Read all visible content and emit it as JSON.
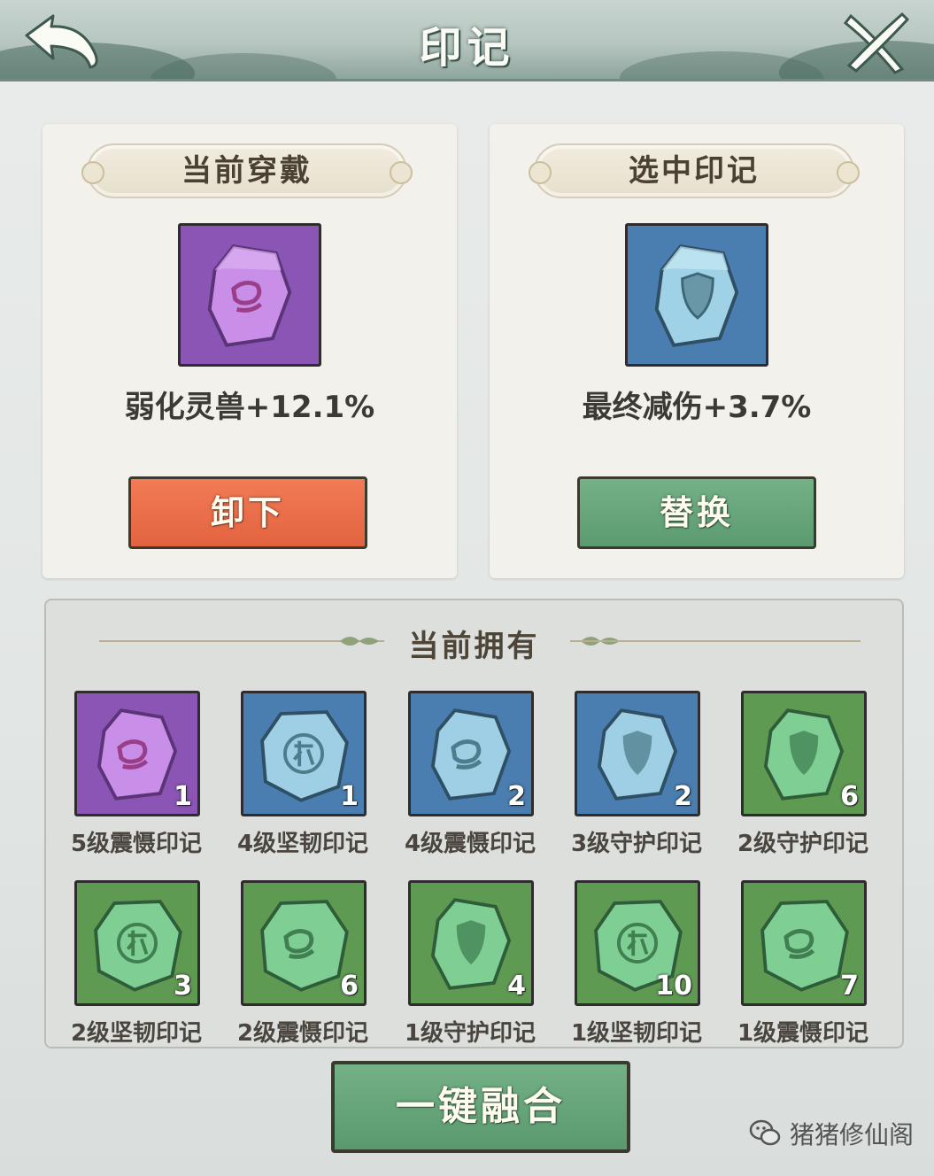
{
  "header": {
    "title": "印记"
  },
  "equipped_panel": {
    "label": "当前穿戴",
    "item_icon": "purple-beast-rune-icon",
    "stat": "弱化灵兽+12.1%",
    "button": "卸下"
  },
  "selected_panel": {
    "label": "选中印记",
    "item_icon": "blue-shield-rune-icon",
    "stat": "最终减伤+3.7%",
    "button": "替换"
  },
  "owned": {
    "title": "当前拥有",
    "items": [
      {
        "name": "5级震慑印记",
        "count": "1",
        "rarity": "purple",
        "glyph": "beast"
      },
      {
        "name": "4级坚韧印记",
        "count": "1",
        "rarity": "blue",
        "glyph": "rune"
      },
      {
        "name": "4级震慑印记",
        "count": "2",
        "rarity": "blue",
        "glyph": "beast"
      },
      {
        "name": "3级守护印记",
        "count": "2",
        "rarity": "blue",
        "glyph": "shield"
      },
      {
        "name": "2级守护印记",
        "count": "6",
        "rarity": "green",
        "glyph": "shield"
      },
      {
        "name": "2级坚韧印记",
        "count": "3",
        "rarity": "green",
        "glyph": "rune"
      },
      {
        "name": "2级震慑印记",
        "count": "6",
        "rarity": "green",
        "glyph": "beast"
      },
      {
        "name": "1级守护印记",
        "count": "4",
        "rarity": "green",
        "glyph": "shield"
      },
      {
        "name": "1级坚韧印记",
        "count": "10",
        "rarity": "green",
        "glyph": "rune"
      },
      {
        "name": "1级震慑印记",
        "count": "7",
        "rarity": "green",
        "glyph": "beast"
      }
    ]
  },
  "fuse_button": "一键融合",
  "watermark": "猪猪修仙阁",
  "colors": {
    "purple": "#8a55b4",
    "blue": "#4a7eb0",
    "green": "#5f9a52",
    "unequip": "#e9694a",
    "replace": "#66a57a"
  }
}
